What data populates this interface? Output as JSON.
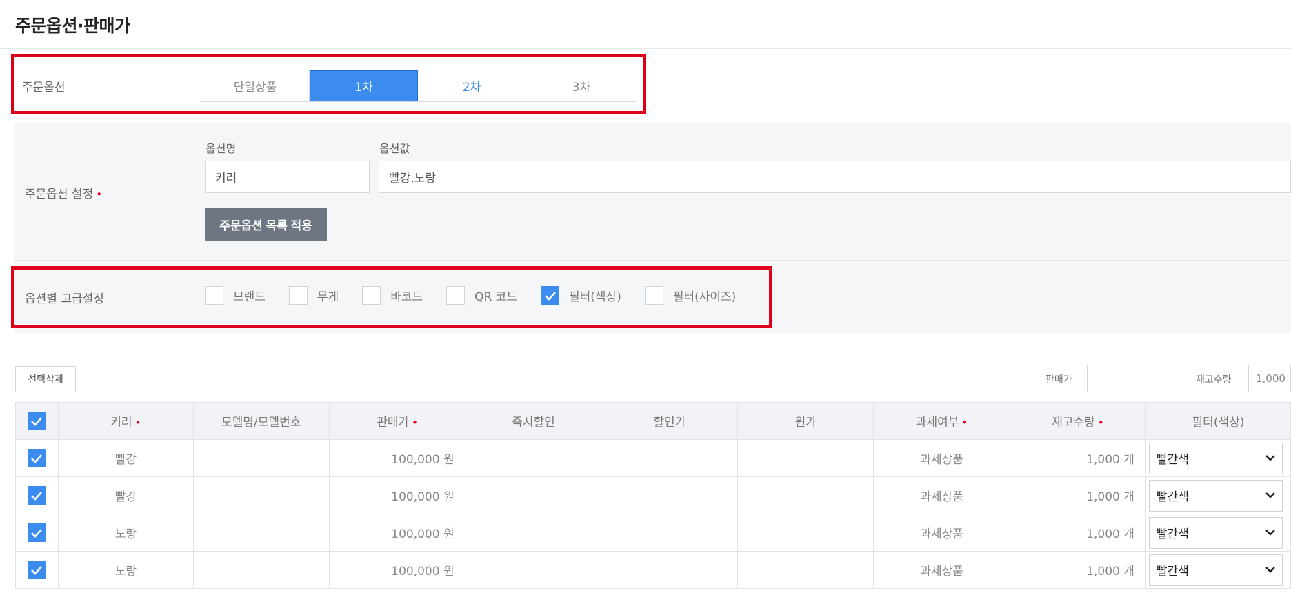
{
  "page_title": "주문옵션·판매가",
  "order_option": {
    "label": "주문옵션",
    "tabs": [
      {
        "label": "단일상품",
        "state": "default"
      },
      {
        "label": "1차",
        "state": "active"
      },
      {
        "label": "2차",
        "state": "link"
      },
      {
        "label": "3차",
        "state": "default"
      }
    ]
  },
  "option_setting": {
    "label": "주문옵션 설정",
    "required_mark": "•",
    "name_label": "옵션명",
    "name_value": "커러",
    "value_label": "옵션값",
    "value_value": "빨강,노랑",
    "apply_button": "주문옵션 목록 적용"
  },
  "advanced": {
    "label": "옵션별 고급설정",
    "checkboxes": [
      {
        "label": "브랜드",
        "checked": false
      },
      {
        "label": "무게",
        "checked": false
      },
      {
        "label": "바코드",
        "checked": false
      },
      {
        "label": "QR 코드",
        "checked": false
      },
      {
        "label": "필터(색상)",
        "checked": true
      },
      {
        "label": "필터(사이즈)",
        "checked": false
      }
    ]
  },
  "toolbar": {
    "delete_button": "선택삭제",
    "price_label": "판매가",
    "price_value": "",
    "stock_label": "재고수량",
    "stock_value": "1,000"
  },
  "table": {
    "columns": [
      "커러",
      "모델명/모델번호",
      "판매가",
      "즉시할인",
      "할인가",
      "원가",
      "과세여부",
      "재고수량",
      "필터(색상)"
    ],
    "required_columns": [
      "커러",
      "판매가",
      "과세여부",
      "재고수량"
    ],
    "rows": [
      {
        "color": "빨강",
        "model": "",
        "price": "100,000 원",
        "instant": "",
        "discount": "",
        "cost": "",
        "tax": "과세상품",
        "stock": "1,000 개",
        "filter": "빨간색"
      },
      {
        "color": "빨강",
        "model": "",
        "price": "100,000 원",
        "instant": "",
        "discount": "",
        "cost": "",
        "tax": "과세상품",
        "stock": "1,000 개",
        "filter": "빨간색"
      },
      {
        "color": "노랑",
        "model": "",
        "price": "100,000 원",
        "instant": "",
        "discount": "",
        "cost": "",
        "tax": "과세상품",
        "stock": "1,000 개",
        "filter": "빨간색"
      },
      {
        "color": "노랑",
        "model": "",
        "price": "100,000 원",
        "instant": "",
        "discount": "",
        "cost": "",
        "tax": "과세상품",
        "stock": "1,000 개",
        "filter": "빨간색"
      }
    ]
  },
  "colors": {
    "accent": "#3c8cf0",
    "highlight": "#e0001b"
  }
}
